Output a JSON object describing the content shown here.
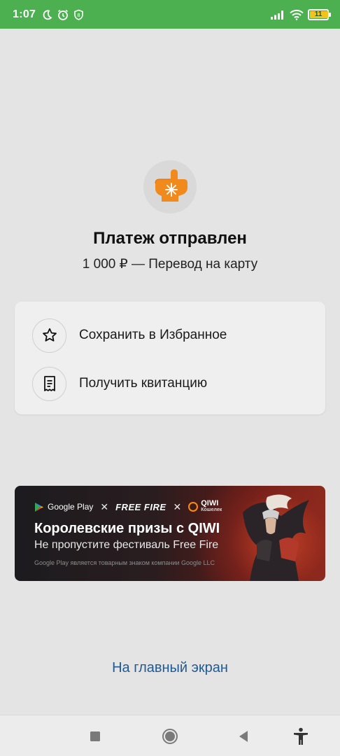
{
  "status_bar": {
    "time": "1:07",
    "battery": "11",
    "icons": [
      "moon-icon",
      "alarm-icon",
      "shield-icon",
      "signal-icon",
      "wifi-icon",
      "battery-icon"
    ]
  },
  "result": {
    "title": "Платеж отправлен",
    "subtitle": "1 000 ₽ — Перевод на карту",
    "icon": "mitten-snowflake-icon"
  },
  "actions": [
    {
      "label": "Сохранить в Избранное",
      "icon": "star-icon"
    },
    {
      "label": "Получить квитанцию",
      "icon": "receipt-icon"
    }
  ],
  "banner": {
    "logos": {
      "google_play": "Google Play",
      "free_fire": "FREE FIRE",
      "qiwi": "QIWI",
      "qiwi_sub": "Кошелек"
    },
    "title": "Королевские призы с QIWI",
    "subtitle": "Не пропустите фестиваль Free Fire",
    "note": "Google Play является товарным знаком компании Google LLC"
  },
  "home_link": "На главный экран",
  "colors": {
    "status_bar": "#4caf50",
    "accent_orange": "#f08a1c",
    "link": "#1f5a93",
    "battery_fill": "#f4c21b"
  },
  "nav_bar": [
    "recents-icon",
    "home-icon",
    "back-icon",
    "accessibility-icon"
  ]
}
